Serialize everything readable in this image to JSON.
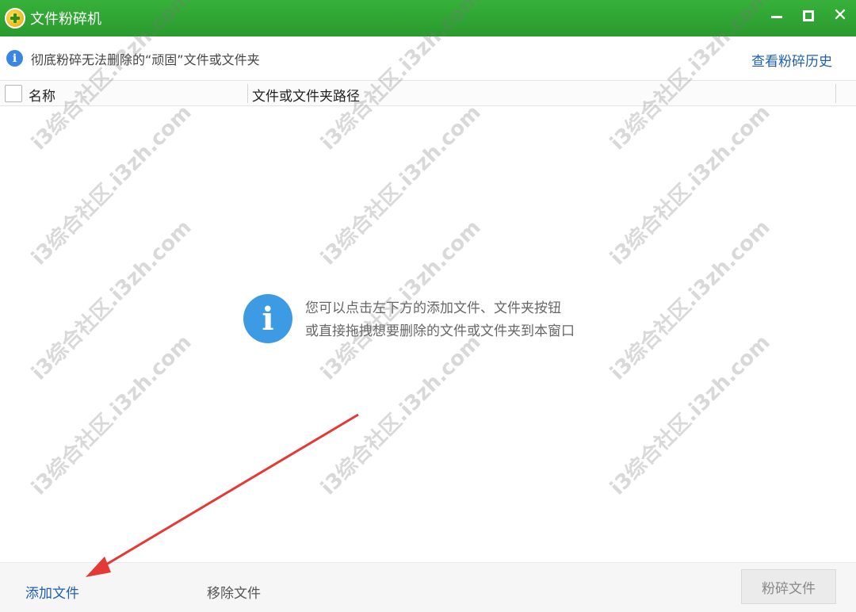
{
  "window": {
    "title": "文件粉碎机",
    "controls": {
      "minimize": "—",
      "maximize": "□",
      "close": "✕"
    }
  },
  "infobar": {
    "text": "彻底粉碎无法删除的“顽固”文件或文件夹",
    "history_link": "查看粉碎历史"
  },
  "table": {
    "columns": [
      "名称",
      "文件或文件夹路径"
    ]
  },
  "empty_state": {
    "line1": "您可以点击左下方的添加文件、文件夹按钮",
    "line2": "或直接拖拽想要删除的文件或文件夹到本窗口"
  },
  "footer": {
    "add_file": "添加文件",
    "remove_file": "移除文件",
    "shred_button": "粉碎文件"
  },
  "watermark": "i3综合社区.i3zh.com",
  "colors": {
    "titlebar": "#2ea432",
    "link_blue": "#1f5fb0",
    "info_icon": "#3d9be4",
    "arrow_red": "#e53935"
  }
}
